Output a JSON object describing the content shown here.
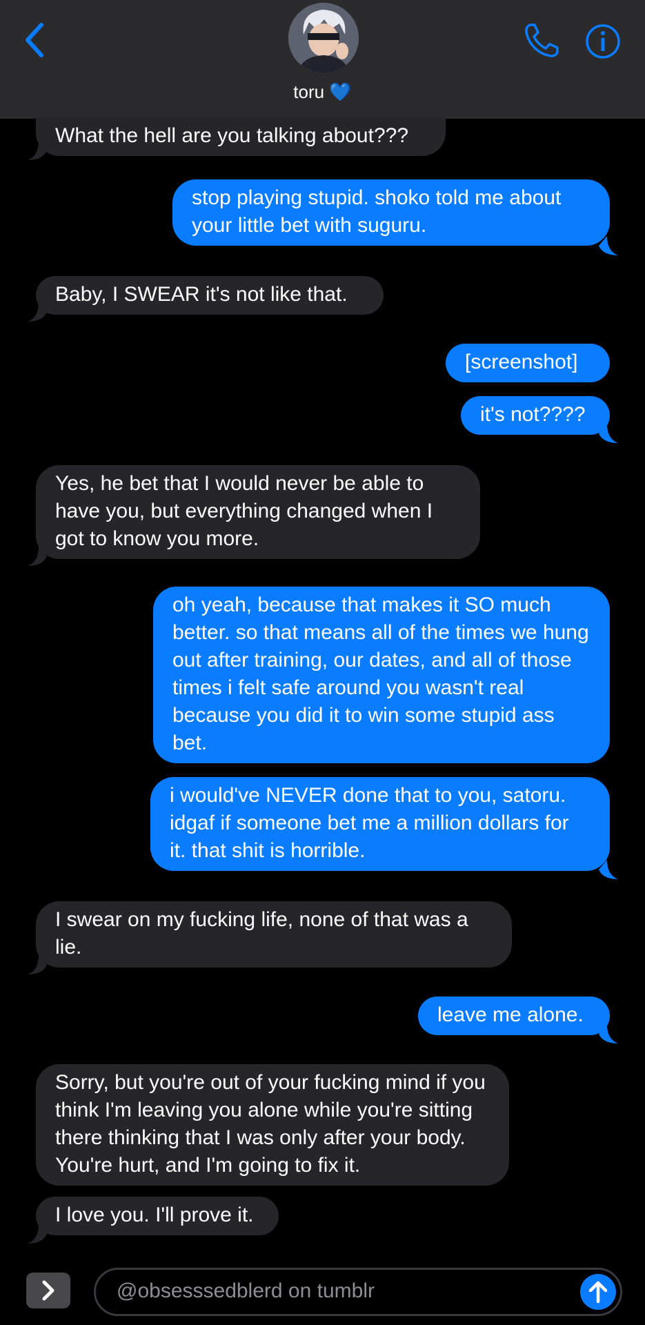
{
  "header": {
    "contact_name": "toru 💙",
    "back_icon": "chevron-left-icon",
    "phone_icon": "phone-icon",
    "info_icon": "info-icon",
    "accent_color": "#0a7cff"
  },
  "messages": [
    {
      "direction": "in",
      "text": "What the hell are you talking about???"
    },
    {
      "direction": "out",
      "text": "stop playing stupid. shoko told me about your little bet with suguru."
    },
    {
      "direction": "in",
      "text": "Baby, I SWEAR it's not like that."
    },
    {
      "direction": "out",
      "text": "[screenshot]"
    },
    {
      "direction": "out",
      "text": "it's not????"
    },
    {
      "direction": "in",
      "text": "Yes, he bet that I would never be able to have you, but everything changed when I got to know you more."
    },
    {
      "direction": "out",
      "text": "oh yeah, because that makes it SO much better. so that means all of the times we hung out after training, our dates, and all of those times i felt safe around you wasn't real because you did it to win some stupid ass bet."
    },
    {
      "direction": "out",
      "text": "i would've NEVER done that to you, satoru. idgaf if someone bet me a million dollars for it. that shit is horrible."
    },
    {
      "direction": "in",
      "text": "I swear on my fucking life, none of that was a lie."
    },
    {
      "direction": "out",
      "text": "leave me alone."
    },
    {
      "direction": "in",
      "text": "Sorry, but you're out of your fucking mind if you think I'm leaving you alone while you're sitting there thinking that I was only after your body. You're hurt, and I'm going to fix it."
    },
    {
      "direction": "in",
      "text": "I love you. I'll prove it."
    }
  ],
  "composer": {
    "placeholder": "@obsesssedblerd on tumblr",
    "apps_icon": "chevron-right-icon",
    "send_icon": "arrow-up-icon"
  },
  "colors": {
    "incoming_bubble": "#26252a",
    "outgoing_bubble": "#0a7cff",
    "header_bg": "#2b2b2d"
  }
}
